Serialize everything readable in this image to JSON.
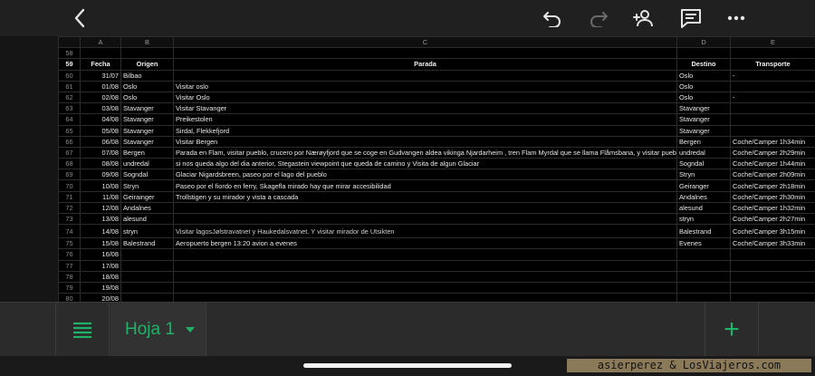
{
  "toolbar": {
    "icons": [
      "back-icon",
      "undo-icon",
      "redo-icon",
      "add-person-icon",
      "comment-icon",
      "more-icon"
    ]
  },
  "sheet": {
    "columns": [
      "A",
      "B",
      "C",
      "D",
      "E"
    ],
    "rows": [
      {
        "n": "58",
        "date": "",
        "origen": "",
        "parada": "",
        "destino": "",
        "transporte": ""
      },
      {
        "n": "59",
        "date": "Fecha",
        "origen": "Origen",
        "parada": "Parada",
        "destino": "Destino",
        "transporte": "Transporte",
        "header": true
      },
      {
        "n": "60",
        "date": "31/07",
        "origen": "Bilbao",
        "parada": "",
        "destino": "Oslo",
        "transporte": "-"
      },
      {
        "n": "61",
        "date": "01/08",
        "origen": "Oslo",
        "parada": "Visitar oslo",
        "destino": "Oslo",
        "transporte": ""
      },
      {
        "n": "62",
        "date": "02/08",
        "origen": "Oslo",
        "parada": "Visitar Oslo",
        "destino": "Oslo",
        "transporte": "-"
      },
      {
        "n": "63",
        "date": "03/08",
        "origen": "Stavanger",
        "parada": "Visitar Stavanger",
        "destino": "Stavanger",
        "transporte": ""
      },
      {
        "n": "64",
        "date": "04/08",
        "origen": "Stavanger",
        "parada": "Preikestolen",
        "destino": "Stavanger",
        "transporte": ""
      },
      {
        "n": "65",
        "date": "05/08",
        "origen": "Stavanger",
        "parada": "Sirdal, Flekkefjord",
        "destino": "Stavanger",
        "transporte": ""
      },
      {
        "n": "66",
        "date": "06/08",
        "origen": "Stavanger",
        "parada": "Visitar Bergen",
        "destino": "Bergen",
        "transporte": "Coche/Camper 1h34min"
      },
      {
        "n": "67",
        "date": "07/08",
        "origen": "Bergen",
        "parada": "Parada en Flam, visitar pueblo, crucero por Nærøyfjord que se coge en Gudvangen aldea vikinga Njardarheim  , tren Flam Myrdal que se llama Flåmsbana, y visitar pueblo",
        "destino": "undredal",
        "transporte": "Coche/Camper 2h29min"
      },
      {
        "n": "68",
        "date": "08/08",
        "origen": "undredal",
        "parada": "si nos queda algo del dia anterior, Stegastein viewpoint que queda de camino y Visita de algun Glaciar",
        "destino": "Sogndal",
        "transporte": "Coche/Camper 1h44min"
      },
      {
        "n": "69",
        "date": "09/08",
        "origen": "Sogndal",
        "parada": "Glaciar Nigardsbreen, paseo por el lago del pueblo",
        "destino": "Stryn",
        "transporte": "Coche/Camper 2h09min"
      },
      {
        "n": "70",
        "date": "10/08",
        "origen": "Stryn",
        "parada": "Paseo por el fiordo en ferry, Skagefla mirado hay que mirar accesibilidad",
        "destino": "Geiranger",
        "transporte": "Coche/Camper 2h18min"
      },
      {
        "n": "71",
        "date": "11/08",
        "origen": "Geirainger",
        "parada": "Trollstigen y su mirador y vista a cascada",
        "destino": "Andalnes",
        "transporte": "Coche/Camper 2h30min"
      },
      {
        "n": "72",
        "date": "12/08",
        "origen": "Andalnes",
        "parada": "",
        "destino": "alesund",
        "transporte": "Coche/Camper 1h32min"
      },
      {
        "n": "73",
        "date": "13/08",
        "origen": "alesund",
        "parada": "",
        "destino": "stryn",
        "transporte": "Coche/Camper 2h27min"
      },
      {
        "n": "74",
        "date": "14/08",
        "origen": "stryn",
        "parada": "Visitar lagosJølstravatnet y Haukedalsvatnet. Y visitar mirador de Utsikten",
        "destino": "Balestrand",
        "transporte": "Coche/Camper 3h15min",
        "tall": true,
        "big": true
      },
      {
        "n": "75",
        "date": "15/08",
        "origen": "Balestrand",
        "parada": "Aeropuerto bergen 13:20 avion a evenes",
        "destino": "Evenes",
        "transporte": "Coche/Camper 3h33min"
      },
      {
        "n": "76",
        "date": "16/08",
        "origen": "",
        "parada": "",
        "destino": "",
        "transporte": ""
      },
      {
        "n": "77",
        "date": "17/08",
        "origen": "",
        "parada": "",
        "destino": "",
        "transporte": ""
      },
      {
        "n": "78",
        "date": "18/08",
        "origen": "",
        "parada": "",
        "destino": "",
        "transporte": ""
      },
      {
        "n": "79",
        "date": "19/08",
        "origen": "",
        "parada": "",
        "destino": "",
        "transporte": ""
      },
      {
        "n": "80",
        "date": "20/08",
        "origen": "",
        "parada": "",
        "destino": "",
        "transporte": ""
      }
    ]
  },
  "bottombar": {
    "sheet_tab_label": "Hoja 1",
    "add_label": "+"
  },
  "watermark": "asierperez & LosViajeros.com",
  "colors": {
    "accent": "#1fb36a",
    "grid_bg": "#000000",
    "toolbar_bg": "#202020"
  }
}
